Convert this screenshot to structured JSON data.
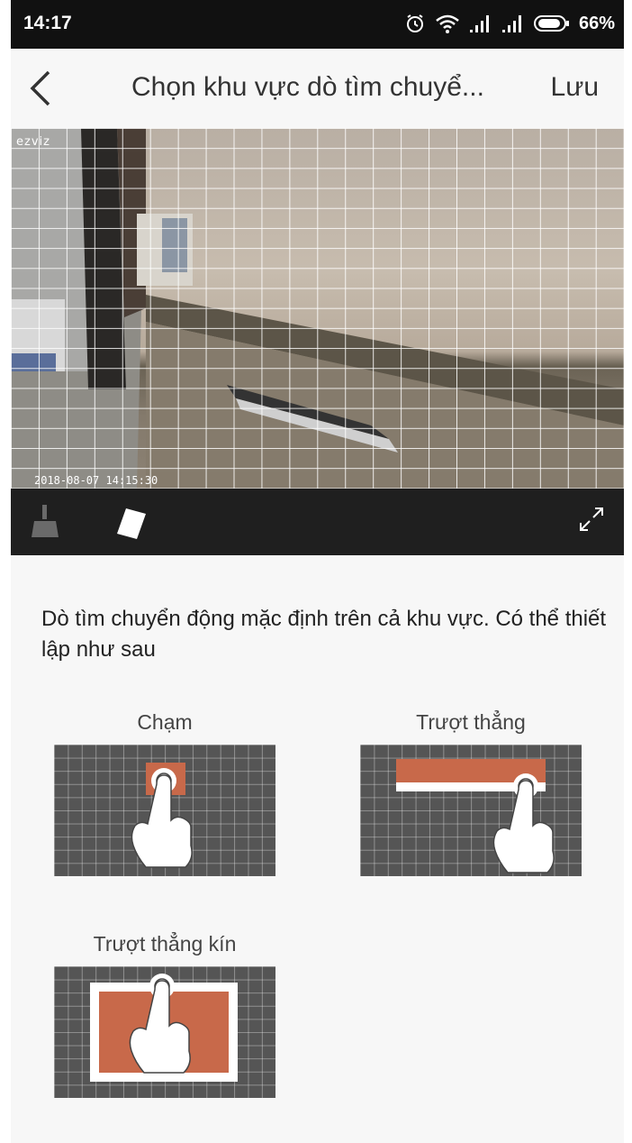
{
  "status_bar": {
    "time": "14:17",
    "battery": "66%",
    "icons": [
      "alarm-icon",
      "wifi-icon",
      "signal-icon",
      "signal-icon",
      "battery-icon"
    ]
  },
  "header": {
    "title": "Chọn khu vực dò tìm chuyể...",
    "save_label": "Lưu",
    "back_icon": "chevron-left-icon"
  },
  "video": {
    "logo": "ezviz",
    "timestamp": "2018-08-07 14:15:30"
  },
  "toolbar": {
    "tools": [
      "broom-icon",
      "eraser-icon",
      "fullscreen-icon"
    ]
  },
  "instructions": {
    "text": "Dò tìm chuyển động mặc định trên cả khu vực. Có thể thiết lập như sau"
  },
  "demos": [
    {
      "label": "Chạm"
    },
    {
      "label": "Trượt thẳng"
    },
    {
      "label": "Trượt thẳng kín"
    }
  ],
  "colors": {
    "highlight": "#c8694a",
    "grid_bg": "#555555",
    "toolbar_bg": "#1f1f1f",
    "page_bg": "#f7f7f7"
  }
}
